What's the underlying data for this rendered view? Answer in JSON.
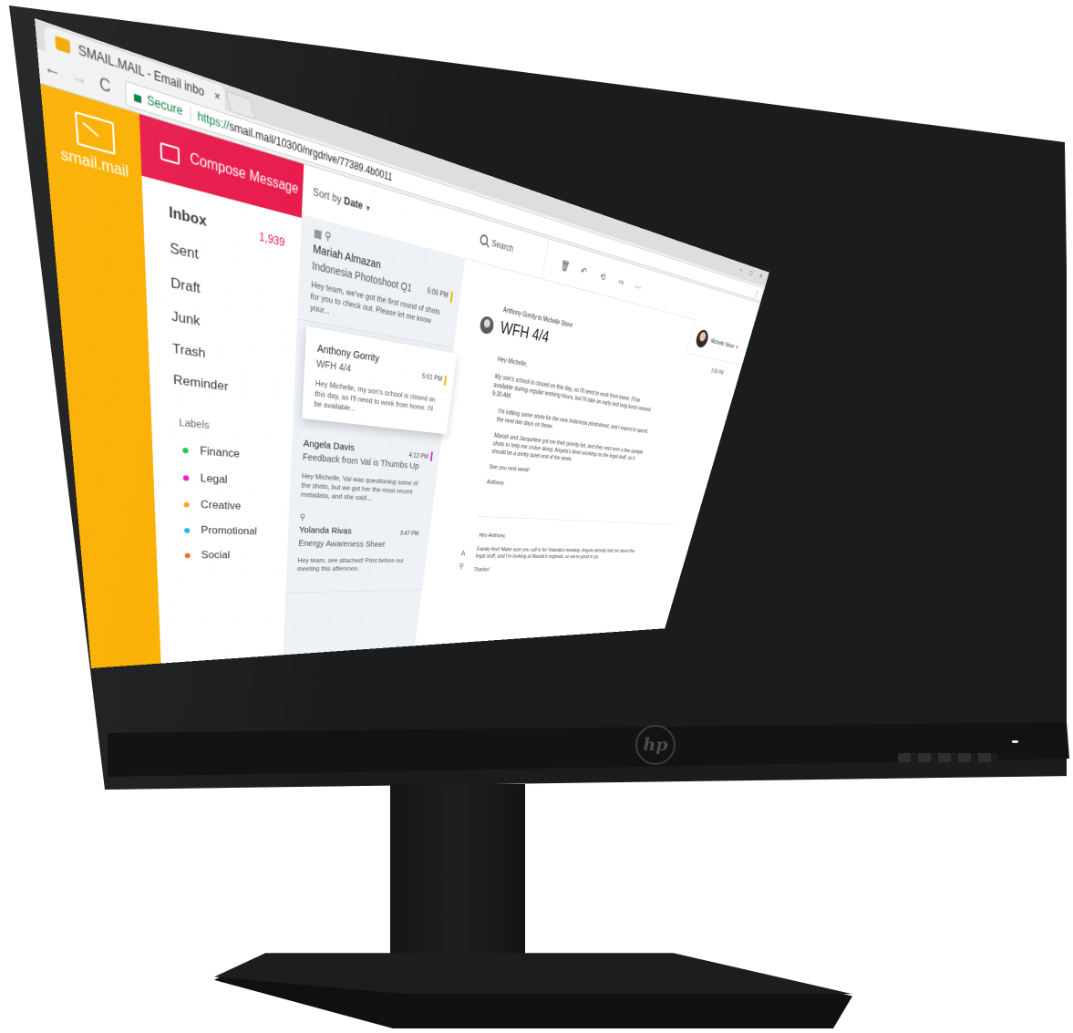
{
  "browser": {
    "tab_title": "SMAIL.MAIL - Email inbo",
    "tab_close": "×",
    "window_controls": "– □ ×",
    "nav": {
      "back": "←",
      "forward": "→",
      "reload": "C"
    },
    "secure_label": "Secure",
    "url_scheme": "https://",
    "url_rest": "smail.mail/10300/nrgdrive/77389.4b0011",
    "menu_icon": "⋮"
  },
  "app": {
    "logo_text": "smail.mail",
    "compose_label": "Compose Message",
    "folders": [
      {
        "label": "Inbox",
        "count": "1,939"
      },
      {
        "label": "Sent"
      },
      {
        "label": "Draft"
      },
      {
        "label": "Junk"
      },
      {
        "label": "Trash"
      },
      {
        "label": "Reminder"
      }
    ],
    "labels_heading": "Labels",
    "labels": [
      {
        "label": "Finance",
        "color": "#23c552"
      },
      {
        "label": "Legal",
        "color": "#e619c8"
      },
      {
        "label": "Creative",
        "color": "#f5a623"
      },
      {
        "label": "Promotional",
        "color": "#1fb5e8"
      },
      {
        "label": "Social",
        "color": "#f36b21"
      }
    ]
  },
  "list": {
    "sort_prefix": "Sort by",
    "sort_value": "Date",
    "messages": [
      {
        "icons": "▦ ⚲",
        "sender": "Mariah Almazan",
        "subject": "Indonesia Photoshoot Q1",
        "time": "5:06 PM",
        "flag_color": "#fbb000",
        "snippet": "Hey team, we've got the first round of shots for you to check out. Please let me know your..."
      },
      {
        "sender": "Anthony Gorrity",
        "subject": "WFH 4/4",
        "time": "5:01 PM",
        "flag_color": "#fbb000",
        "snippet": "Hey Michelle, my son's school is closed on this day, so I'll need to work from home. I'll be available..."
      },
      {
        "sender": "Angela Davis",
        "subject": "Feedback from Val is Thumbs Up",
        "time": "4:12 PM",
        "flag_color": "#e619c8",
        "snippet": "Hey Michelle, Val was questioning some of the shots, but we got her the most recent metadata, and she said..."
      },
      {
        "icons": "⚲",
        "sender": "Yolanda Rivas",
        "subject": "Energy Awareness Sheet",
        "time": "3:47 PM",
        "snippet": "Hey team, see attached! Print before our meeting this afternoon."
      }
    ]
  },
  "pane": {
    "search_label": "Search",
    "toolbar_icons": {
      "delete": "🗑",
      "reply": "↶",
      "reply_all": "⟲",
      "forward": "⇨",
      "more": "⋯"
    },
    "user_name": "Michelle Stone",
    "mail": {
      "meta": "Anthony Gorrity to Michelle Stone",
      "subject": "WFH 4/4",
      "time": "5:06 PM",
      "greeting": "Hey Michelle,",
      "p1": "My son's school is closed on this day, so I'll need to work from home. I'll be available during regular working hours, but I'll take an early and long lunch around 9:30 AM.",
      "p2": "I'm editing some shots for the new Indonesia photoshoot, and I expect to spend the next two days on those.",
      "p3": "Mariah and Jacqueline got me their priority list, and they sent over a few sample shots to help me cruise along. Angela's been working on the legal stuff, so it should be a pretty quiet end of the week.",
      "signoff": "See you next week!",
      "signature": "Anthony"
    },
    "reply": {
      "greeting": "Hey Anthony,",
      "body": "Family first! Make sure you call in for Yolanda's meeting. Angela already told me about the legal stuff, and I'm looking at Mariah's originals, so we're good to go.",
      "closing": "Thanks!",
      "format_icon": "A",
      "attach_icon": "⚲"
    }
  },
  "hardware": {
    "brand": "hp"
  }
}
